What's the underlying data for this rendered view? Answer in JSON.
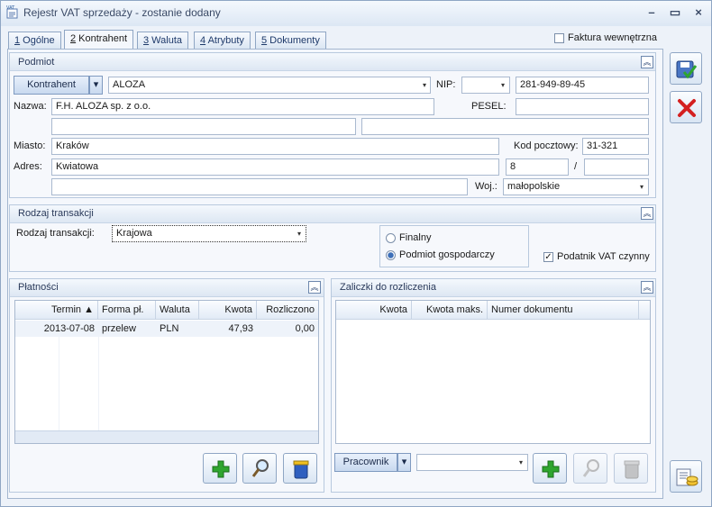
{
  "window": {
    "title": "Rejestr VAT sprzedaży - zostanie dodany",
    "icon_text": "VAT"
  },
  "tabs": [
    {
      "num": "1",
      "label": " Ogólne"
    },
    {
      "num": "2",
      "label": " Kontrahent"
    },
    {
      "num": "3",
      "label": " Waluta"
    },
    {
      "num": "4",
      "label": " Atrybuty"
    },
    {
      "num": "5",
      "label": " Dokumenty"
    }
  ],
  "faktura_wewnetrzna": {
    "label": "Faktura wewnętrzna",
    "checked": false
  },
  "podmiot": {
    "title": "Podmiot",
    "kontrahent_button": "Kontrahent",
    "kontrahent_value": "ALOZA",
    "nip_label": "NIP:",
    "nip_prefix": "",
    "nip_value": "281-949-89-45",
    "nazwa_label": "Nazwa:",
    "nazwa_value": "F.H. ALOZA sp. z o.o.",
    "pesel_label": "PESEL:",
    "pesel_value": "",
    "miasto_label": "Miasto:",
    "miasto_value": "Kraków",
    "kod_label": "Kod pocztowy:",
    "kod_value": "31-321",
    "adres_label": "Adres:",
    "adres_value": "Kwiatowa",
    "nr_domu": "8",
    "slash": "/",
    "nr_lokalu": "",
    "woj_label": "Woj.:",
    "woj_value": "małopolskie"
  },
  "rodzaj": {
    "title": "Rodzaj transakcji",
    "label": "Rodzaj transakcji:",
    "value": "Krajowa",
    "radio_finalny": "Finalny",
    "radio_podmiot": "Podmiot gospodarczy",
    "podatnik_label": "Podatnik VAT czynny",
    "podatnik_checked": true
  },
  "platnosci": {
    "title": "Płatności",
    "columns": [
      "Termin ▲",
      "Forma pł.",
      "Waluta",
      "Kwota",
      "Rozliczono"
    ],
    "rows": [
      {
        "termin": "2013-07-08",
        "forma": "przelew",
        "waluta": "PLN",
        "kwota": "47,93",
        "rozliczono": "0,00"
      }
    ]
  },
  "zaliczki": {
    "title": "Zaliczki do rozliczenia",
    "columns": [
      "Kwota",
      "Kwota maks.",
      "Numer dokumentu"
    ],
    "pracownik_button": "Pracownik",
    "pracownik_value": ""
  },
  "colors": {
    "accent": "#2f5f9f",
    "add_green": "#2fa52f",
    "cancel_red": "#d42020"
  }
}
